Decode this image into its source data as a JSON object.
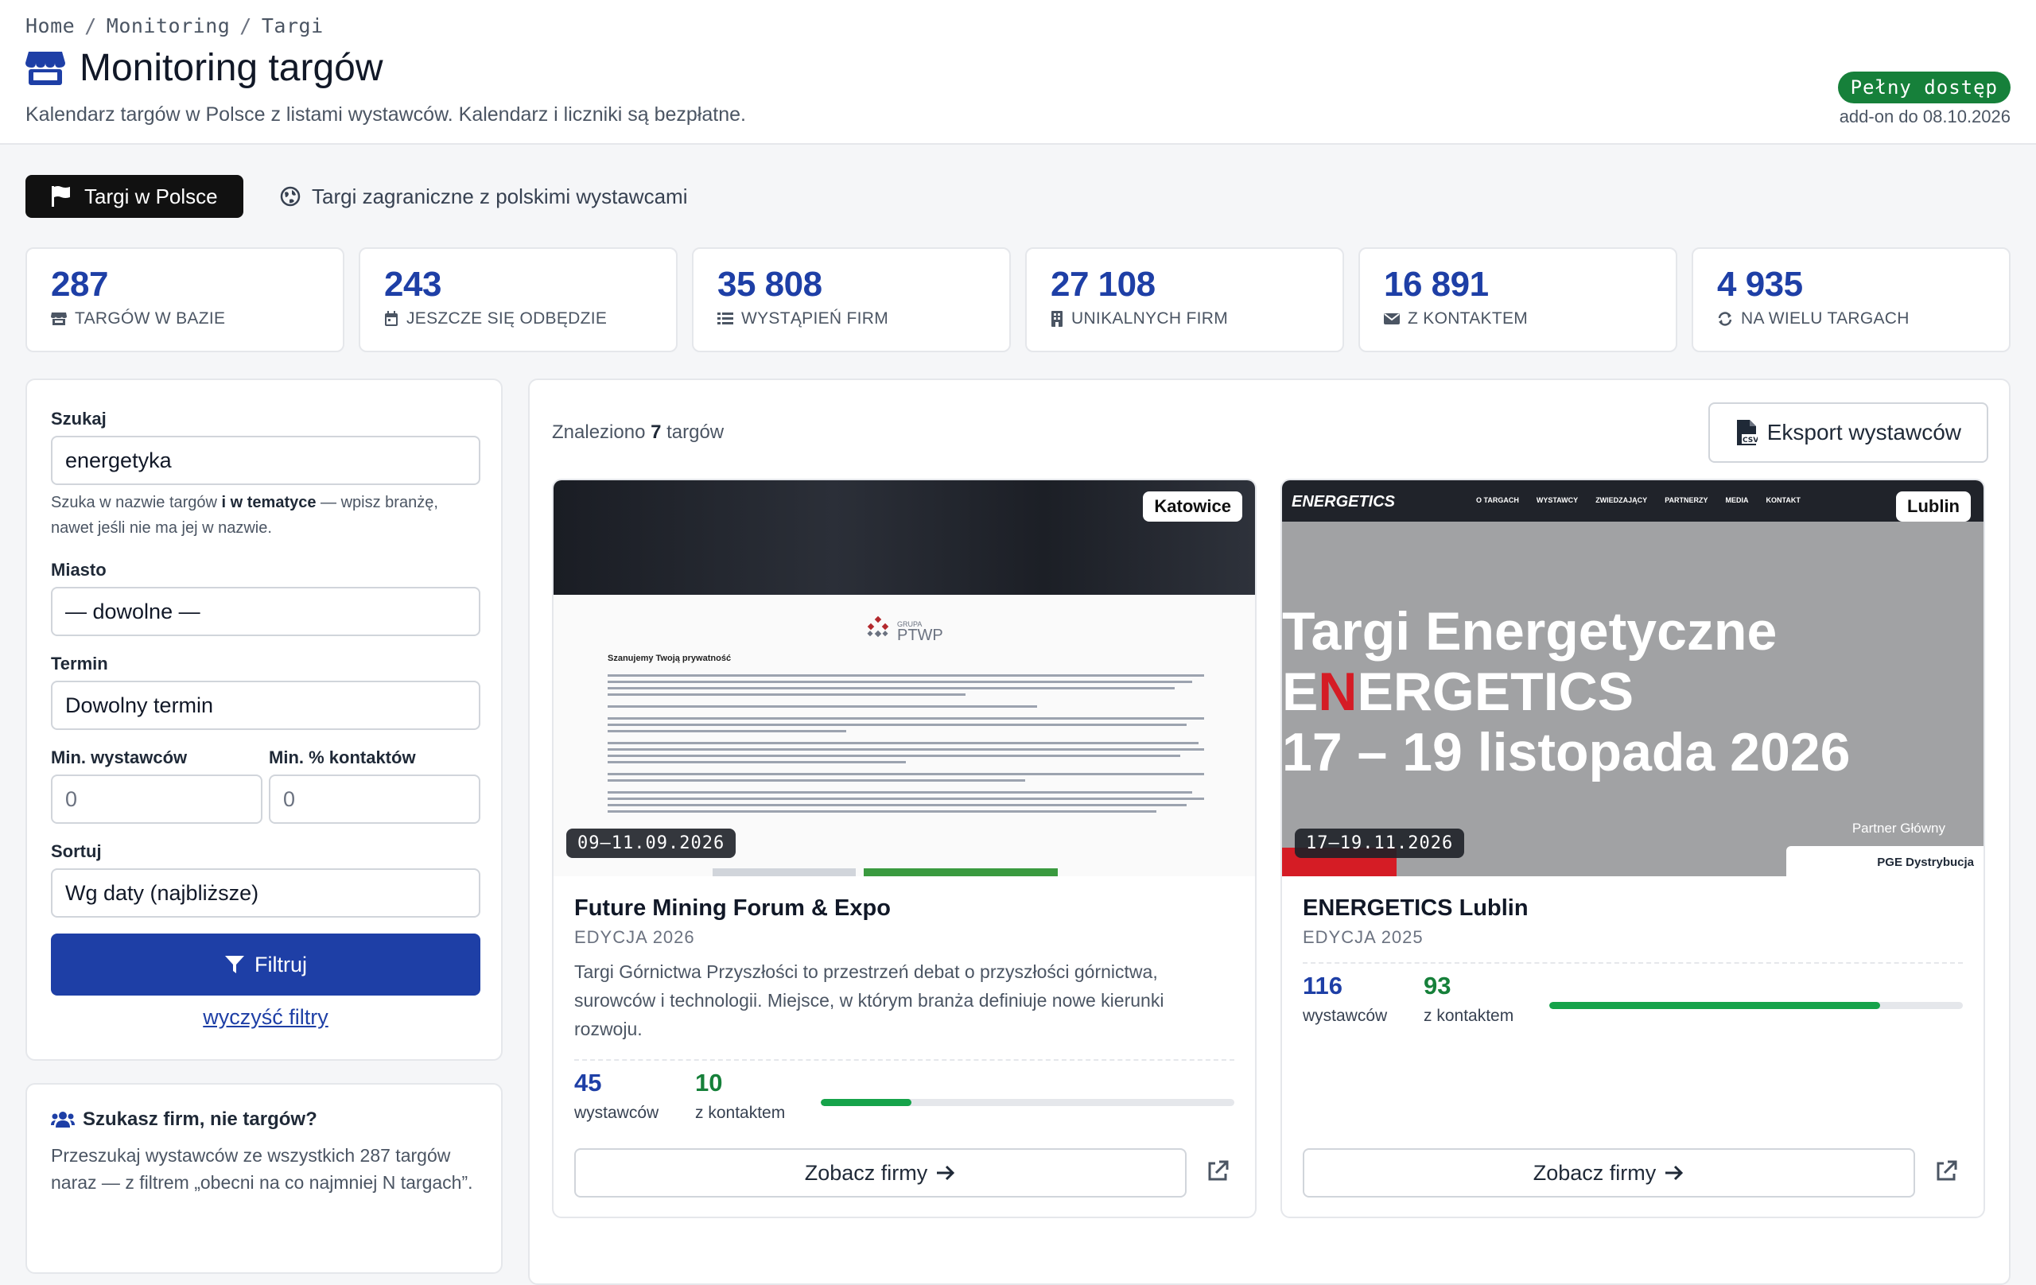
{
  "breadcrumb": [
    "Home",
    "Monitoring",
    "Targi"
  ],
  "page": {
    "title": "Monitoring targów",
    "subtitle": "Kalendarz targów w Polsce z listami wystawców. Kalendarz i liczniki są bezpłatne.",
    "access_badge": "Pełny dostęp",
    "addon_text": "add-on do 08.10.2026"
  },
  "tabs": {
    "active": "Targi w Polsce",
    "other": "Targi zagraniczne z polskimi wystawcami"
  },
  "stats": [
    {
      "value": "287",
      "label": "TARGÓW W BAZIE",
      "icon": "store-icon"
    },
    {
      "value": "243",
      "label": "JESZCZE SIĘ ODBĘDZIE",
      "icon": "calendar-icon"
    },
    {
      "value": "35 808",
      "label": "WYSTĄPIEŃ FIRM",
      "icon": "list-icon"
    },
    {
      "value": "27 108",
      "label": "UNIKALNYCH FIRM",
      "icon": "building-icon"
    },
    {
      "value": "16 891",
      "label": "Z KONTAKTEM",
      "icon": "envelope-icon"
    },
    {
      "value": "4 935",
      "label": "NA WIELU TARGACH",
      "icon": "repeat-icon"
    }
  ],
  "filters": {
    "search_label": "Szukaj",
    "search_value": "energetyka",
    "search_hint_pre": "Szuka w nazwie targów ",
    "search_hint_bold": "i w tematyce",
    "search_hint_post": " — wpisz branżę, nawet jeśli nie ma jej w nazwie.",
    "city_label": "Miasto",
    "city_value": "— dowolne —",
    "term_label": "Termin",
    "term_value": "Dowolny termin",
    "min_exhibitors_label": "Min. wystawców",
    "min_exhibitors_value": "0",
    "min_contacts_label": "Min. % kontaktów",
    "min_contacts_value": "0",
    "sort_label": "Sortuj",
    "sort_value": "Wg daty (najbliższe)",
    "filter_button": "Filtruj",
    "clear_link": "wyczyść filtry"
  },
  "promo": {
    "title": "Szukasz firm, nie targów?",
    "text": "Przeszukaj wystawców ze wszystkich 287 targów naraz — z filtrem „obecni na co najmniej N targach”."
  },
  "results": {
    "found_pre": "Znaleziono ",
    "found_count": "7",
    "found_post": " targów",
    "export_button": "Eksport wystawców"
  },
  "cards": [
    {
      "city": "Katowice",
      "date": "09–11.09.2026",
      "title": "Future Mining Forum & Expo",
      "edition": "EDYCJA 2026",
      "description": "Targi Górnictwa Przyszłości to przestrzeń debat o przyszłości górnictwa, surowców i technologii. Miejsce, w którym branża definiuje nowe kierunki rozwoju.",
      "exhibitors": "45",
      "exhibitors_label": "wystawców",
      "contacts": "10",
      "contacts_label": "z kontaktem",
      "contact_ratio": 0.22,
      "button": "Zobacz firmy",
      "thumb": {
        "logo_text": "PTWP",
        "logo_small": "GRUPA",
        "heading": "Szanujemy Twoją prywatność"
      }
    },
    {
      "city": "Lublin",
      "date": "17–19.11.2026",
      "title": "ENERGETICS Lublin",
      "edition": "EDYCJA 2025",
      "description": "",
      "exhibitors": "116",
      "exhibitors_label": "wystawców",
      "contacts": "93",
      "contacts_label": "z kontaktem",
      "contact_ratio": 0.8,
      "button": "Zobacz firmy",
      "thumb": {
        "logo_text": "ENERGETICS",
        "menu": [
          "O TARGACH",
          "WYSTAWCY",
          "ZWIEDZAJĄCY",
          "PARTNERZY",
          "MEDIA",
          "KONTAKT"
        ],
        "headline_1": "Targi Energetyczne",
        "headline_2a": "E",
        "headline_2b": "N",
        "headline_2c": "ERGETICS",
        "headline_3": "17 – 19 listopada 2026",
        "partner_label": "Partner Główny",
        "partner_name": "PGE Dystrybucja"
      }
    }
  ],
  "colors": {
    "primary": "#1e3fa6",
    "success": "#16803a",
    "bar_fill": "#16a34a"
  }
}
